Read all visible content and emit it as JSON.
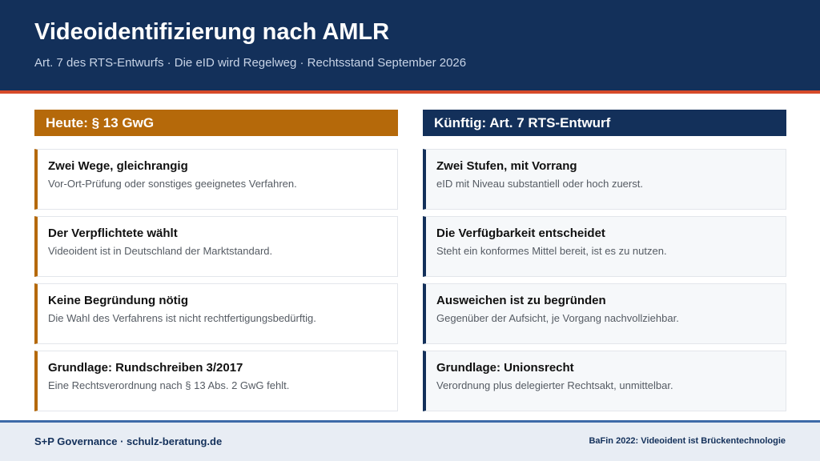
{
  "header": {
    "title": "Videoidentifizierung nach AMLR",
    "subtitle": "Art. 7 des RTS-Entwurfs  ·  Die eID wird Regelweg  ·  Rechtsstand September 2026",
    "accent_color": "#d64a2a",
    "background_color": "#13305a"
  },
  "left_column": {
    "heading": "Heute: § 13 GwG",
    "accent_color": "#b5690a",
    "cards": [
      {
        "title": "Zwei Wege, gleichrangig",
        "text": "Vor-Ort-Prüfung oder sonstiges geeignetes Verfahren."
      },
      {
        "title": "Der Verpflichtete wählt",
        "text": "Videoident ist in Deutschland der Marktstandard."
      },
      {
        "title": "Keine Begründung nötig",
        "text": "Die Wahl des Verfahrens ist nicht rechtfertigungsbedürftig."
      },
      {
        "title": "Grundlage: Rundschreiben 3/2017",
        "text": "Eine Rechtsverordnung nach § 13 Abs. 2 GwG fehlt."
      }
    ]
  },
  "right_column": {
    "heading": "Künftig: Art. 7 RTS-Entwurf",
    "accent_color": "#13305a",
    "cards": [
      {
        "title": "Zwei Stufen, mit Vorrang",
        "text": "eID mit Niveau substantiell oder hoch zuerst."
      },
      {
        "title": "Die Verfügbarkeit entscheidet",
        "text": "Steht ein konformes Mittel bereit, ist es zu nutzen."
      },
      {
        "title": "Ausweichen ist zu begründen",
        "text": "Gegenüber der Aufsicht, je Vorgang nachvollziehbar."
      },
      {
        "title": "Grundlage: Unionsrecht",
        "text": "Verordnung plus delegierter Rechtsakt, unmittelbar."
      }
    ]
  },
  "footer": {
    "left": "S+P Governance  ·  schulz-beratung.de",
    "right": "BaFin 2022: Videoident ist Brückentechnologie"
  }
}
